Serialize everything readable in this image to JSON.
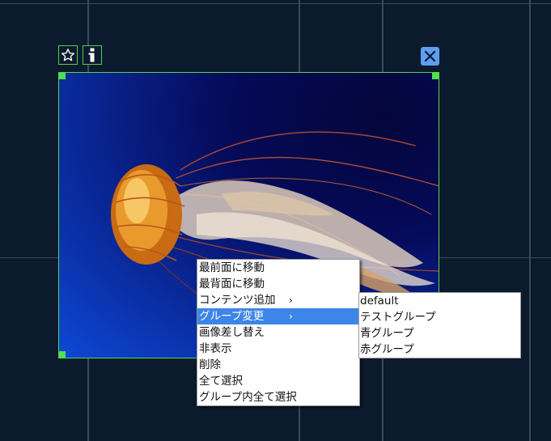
{
  "toolbar": {
    "favorite_icon": "star-outline-icon",
    "info_icon": "info-icon",
    "close_icon": "close-icon"
  },
  "image": {
    "subject": "jellyfish-photo"
  },
  "context_menu": {
    "items": [
      {
        "label": "最前面に移動"
      },
      {
        "label": "最背面に移動"
      },
      {
        "label": "コンテンツ追加",
        "arrow": "›"
      },
      {
        "label": "グループ変更",
        "arrow": "›"
      },
      {
        "label": "画像差し替え"
      },
      {
        "label": "非表示"
      },
      {
        "label": "削除"
      },
      {
        "label": "全て選択"
      },
      {
        "label": "グループ内全て選択"
      }
    ],
    "selected_index": 3
  },
  "submenu": {
    "items": [
      {
        "label": "default"
      },
      {
        "label": "テストグループ"
      },
      {
        "label": "青グループ"
      },
      {
        "label": "赤グループ"
      }
    ]
  },
  "colors": {
    "background": "#0c1a2d",
    "selection_border": "#54d454",
    "menu_highlight": "#3d85e6",
    "close_button": "#5e9ef0"
  }
}
